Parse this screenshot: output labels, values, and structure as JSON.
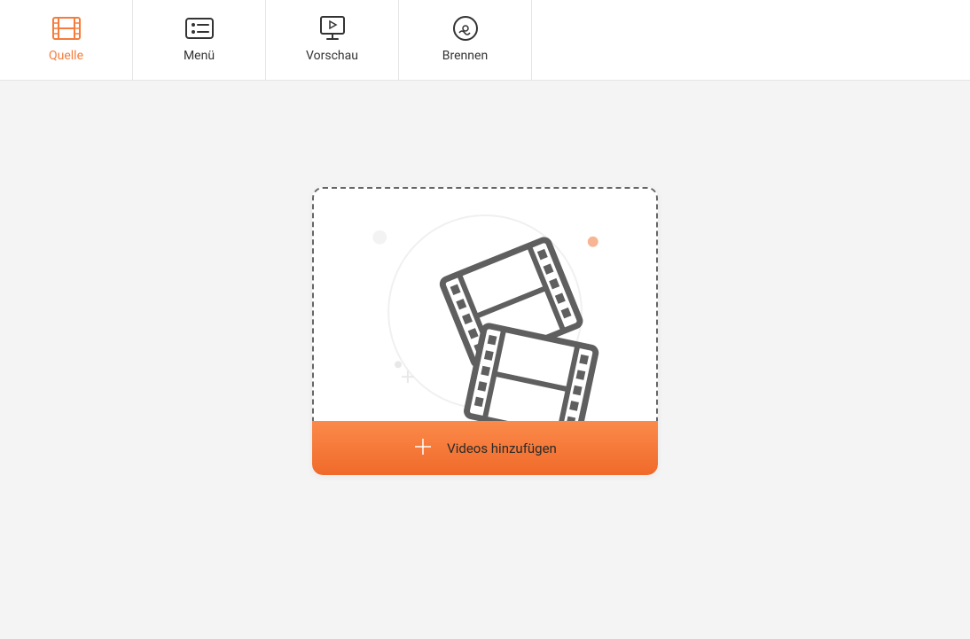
{
  "tabs": {
    "quelle": {
      "label": "Quelle"
    },
    "menu": {
      "label": "Menü"
    },
    "vorschau": {
      "label": "Vorschau"
    },
    "brennen": {
      "label": "Brennen"
    }
  },
  "addButton": {
    "label": "Videos hinzufügen"
  },
  "colors": {
    "accent": "#f57c3a",
    "buttonGradientTop": "#fb8a4a",
    "buttonGradientBottom": "#f06a2a"
  }
}
